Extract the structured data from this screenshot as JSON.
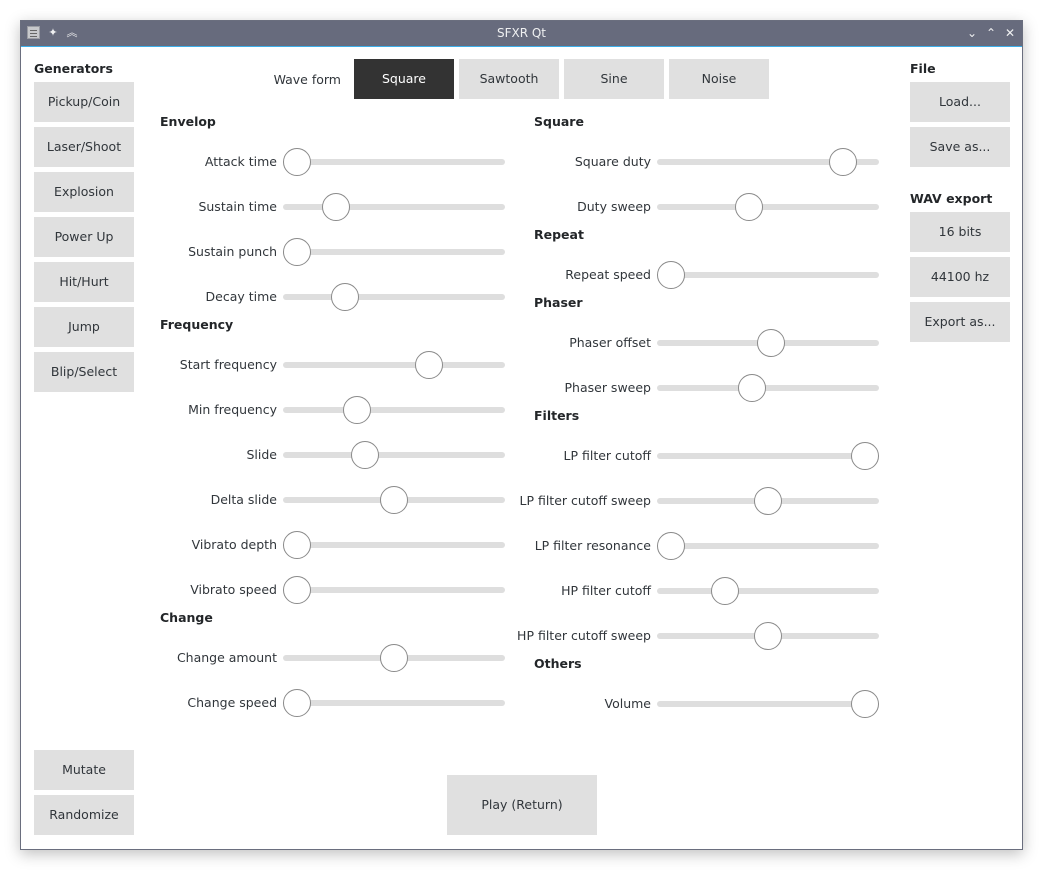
{
  "window": {
    "title": "SFXR Qt",
    "titlebar_icons": [
      "app-menu-icon",
      "pin-icon",
      "keep-above-icon"
    ],
    "controls": {
      "minimize": "⌄",
      "maximize": "⌃",
      "close": "✕"
    }
  },
  "generators": {
    "title": "Generators",
    "items": [
      {
        "label": "Pickup/Coin"
      },
      {
        "label": "Laser/Shoot"
      },
      {
        "label": "Explosion"
      },
      {
        "label": "Power Up"
      },
      {
        "label": "Hit/Hurt"
      },
      {
        "label": "Jump"
      },
      {
        "label": "Blip/Select"
      }
    ],
    "mutate_label": "Mutate",
    "randomize_label": "Randomize"
  },
  "waveform": {
    "label": "Wave form",
    "options": [
      {
        "label": "Square",
        "selected": true
      },
      {
        "label": "Sawtooth",
        "selected": false
      },
      {
        "label": "Sine",
        "selected": false
      },
      {
        "label": "Noise",
        "selected": false
      }
    ]
  },
  "left_sections": [
    {
      "title": "Envelop",
      "sliders": [
        {
          "label": "Attack time",
          "value": 0.0
        },
        {
          "label": "Sustain time",
          "value": 0.2
        },
        {
          "label": "Sustain punch",
          "value": 0.0
        },
        {
          "label": "Decay time",
          "value": 0.245
        }
      ]
    },
    {
      "title": "Frequency",
      "sliders": [
        {
          "label": "Start frequency",
          "value": 0.68
        },
        {
          "label": "Min frequency",
          "value": 0.31
        },
        {
          "label": "Slide",
          "value": 0.35
        },
        {
          "label": "Delta slide",
          "value": 0.5
        },
        {
          "label": "Vibrato depth",
          "value": 0.0
        },
        {
          "label": "Vibrato speed",
          "value": 0.0
        }
      ]
    },
    {
      "title": "Change",
      "sliders": [
        {
          "label": "Change amount",
          "value": 0.5
        },
        {
          "label": "Change speed",
          "value": 0.0
        }
      ]
    }
  ],
  "right_sections": [
    {
      "title": "Square",
      "sliders": [
        {
          "label": "Square duty",
          "value": 0.885
        },
        {
          "label": "Duty sweep",
          "value": 0.4
        }
      ]
    },
    {
      "title": "Repeat",
      "sliders": [
        {
          "label": "Repeat speed",
          "value": 0.0
        }
      ]
    },
    {
      "title": "Phaser",
      "sliders": [
        {
          "label": "Phaser offset",
          "value": 0.515
        },
        {
          "label": "Phaser sweep",
          "value": 0.415
        }
      ]
    },
    {
      "title": "Filters",
      "sliders": [
        {
          "label": "LP filter cutoff",
          "value": 1.0
        },
        {
          "label": "LP filter cutoff sweep",
          "value": 0.5
        },
        {
          "label": "LP filter resonance",
          "value": 0.0
        },
        {
          "label": "HP filter cutoff",
          "value": 0.28
        },
        {
          "label": "HP filter cutoff sweep",
          "value": 0.5
        }
      ]
    },
    {
      "title": "Others",
      "sliders": [
        {
          "label": "Volume",
          "value": 1.0
        }
      ]
    }
  ],
  "file": {
    "title": "File",
    "load_label": "Load...",
    "save_label": "Save as..."
  },
  "wav_export": {
    "title": "WAV export",
    "bits_label": "16 bits",
    "rate_label": "44100 hz",
    "export_label": "Export as..."
  },
  "play_label": "Play (Return)",
  "colors": {
    "titlebar": "#676b7d",
    "titlebar_accent": "#3daee9",
    "button_bg": "#e0e0e0",
    "button_active_bg": "#333333",
    "slider_track": "#dedede"
  }
}
